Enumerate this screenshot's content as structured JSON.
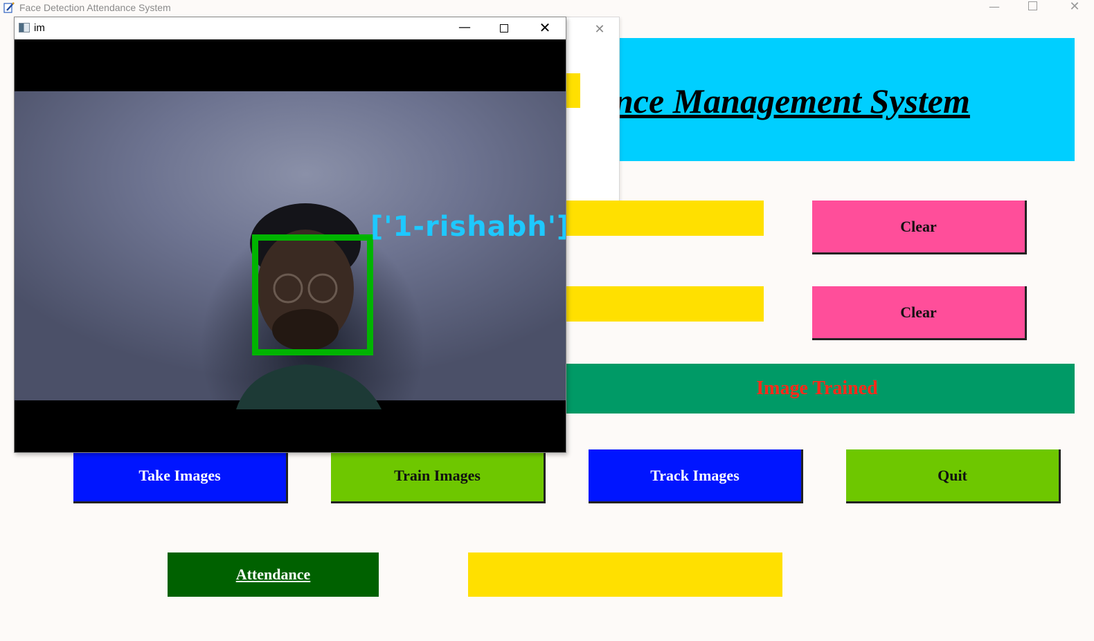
{
  "main_window": {
    "title": "Face Detection Attendance System",
    "minimize_glyph": "—",
    "close_glyph": "✕"
  },
  "header": {
    "title_visible": "nce Management System"
  },
  "dialog": {
    "close_glyph": "✕"
  },
  "form": {
    "id_value": "",
    "name_value": "",
    "clear_label_1": "Clear",
    "clear_label_2": "Clear"
  },
  "status": {
    "message": "Image Trained"
  },
  "actions": {
    "take_images": "Take Images",
    "train_images": "Train Images",
    "track_images": "Track Images",
    "quit": "Quit",
    "attendance": "Attendance",
    "attendance_output": ""
  },
  "camera_window": {
    "title": "im",
    "minimize_glyph": "—",
    "close_glyph": "✕",
    "recognized_label": "['1-rishabh']"
  },
  "colors": {
    "header_bg": "#00cfff",
    "entry_bg": "#ffe000",
    "clear_bg": "#ff4e9a",
    "status_bg": "#009a66",
    "status_text": "#ff2a1a",
    "blue_btn": "#0015ff",
    "green_btn": "#6ec700",
    "attendance_bg": "#006100",
    "face_box": "#00b400",
    "face_label": "#1ec8ff"
  },
  "icons": {
    "app_icon": "notepad-pen-icon",
    "camera_window_icon": "opencv-window-icon"
  }
}
